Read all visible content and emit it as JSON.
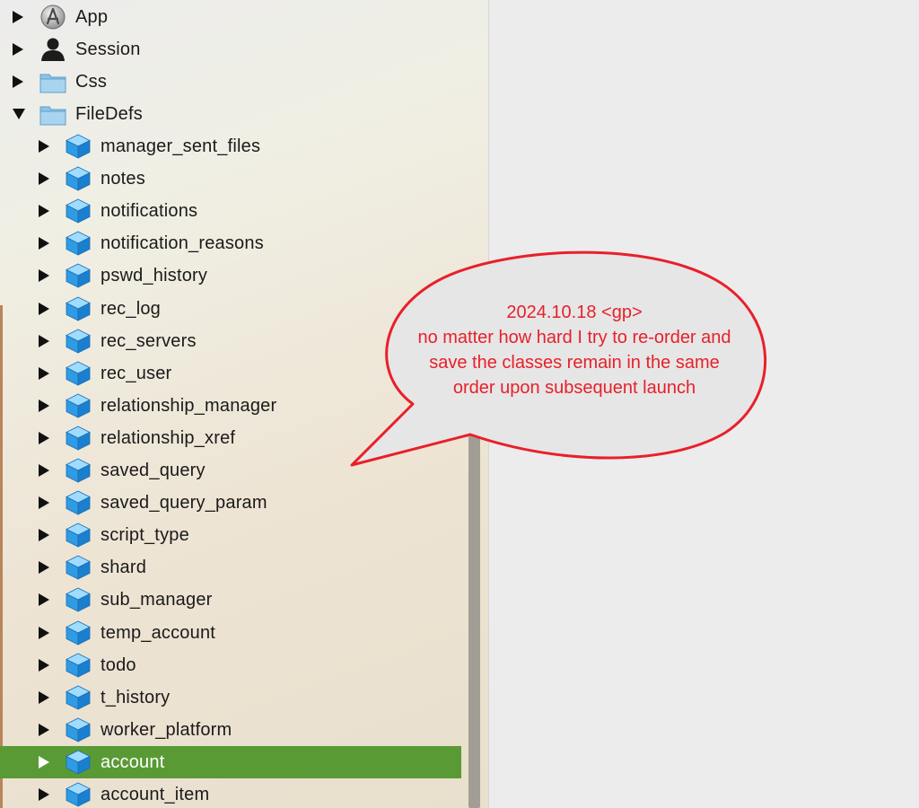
{
  "tree": {
    "top_items": [
      {
        "label": "App",
        "icon": "app-store-icon",
        "expanded": false
      },
      {
        "label": "Session",
        "icon": "person-icon",
        "expanded": false
      },
      {
        "label": "Css",
        "icon": "folder-icon",
        "expanded": false
      },
      {
        "label": "FileDefs",
        "icon": "folder-icon",
        "expanded": true
      }
    ],
    "children": [
      {
        "label": "manager_sent_files"
      },
      {
        "label": "notes"
      },
      {
        "label": "notifications"
      },
      {
        "label": "notification_reasons"
      },
      {
        "label": "pswd_history"
      },
      {
        "label": "rec_log"
      },
      {
        "label": "rec_servers"
      },
      {
        "label": "rec_user"
      },
      {
        "label": "relationship_manager"
      },
      {
        "label": "relationship_xref"
      },
      {
        "label": "saved_query"
      },
      {
        "label": "saved_query_param"
      },
      {
        "label": "script_type"
      },
      {
        "label": "shard"
      },
      {
        "label": "sub_manager"
      },
      {
        "label": "temp_account"
      },
      {
        "label": "todo"
      },
      {
        "label": "t_history"
      },
      {
        "label": "worker_platform"
      },
      {
        "label": "account",
        "selected": true
      },
      {
        "label": "account_item"
      }
    ],
    "child_icon": "cube-icon",
    "selection_color": "#5a9a35"
  },
  "callout": {
    "lines": [
      "2024.10.18 <gp>",
      "no matter how hard I try to re-order and",
      "save the classes remain in the same",
      "order upon subsequent launch"
    ],
    "text_color": "#e8202a",
    "border_color": "#e8202a"
  }
}
